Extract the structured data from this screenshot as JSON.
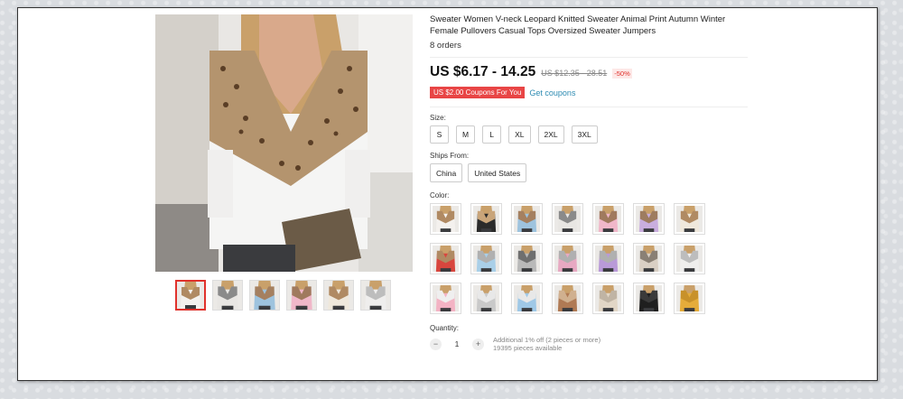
{
  "product": {
    "title": "Sweater Women V-neck Leopard Knitted Sweater Animal Print Autumn Winter Female Pullovers Casual Tops Oversized Sweater Jumpers",
    "orders": "8 orders",
    "price": "US $6.17 - 14.25",
    "old_price": "US $12.35 - 28.51",
    "discount": "-50%",
    "coupon_badge": "US $2.00 Coupons For You",
    "get_coupons": "Get coupons"
  },
  "size": {
    "label": "Size:",
    "options": [
      "S",
      "M",
      "L",
      "XL",
      "2XL",
      "3XL"
    ]
  },
  "ships_from": {
    "label": "Ships From:",
    "options": [
      "China",
      "United States"
    ]
  },
  "color": {
    "label": "Color:",
    "swatches": [
      {
        "body": "#f4f1ee",
        "band": "#b08a63"
      },
      {
        "body": "#2b2b2b",
        "band": "#c9a57a"
      },
      {
        "body": "#9ec3de",
        "band": "#a58060"
      },
      {
        "body": "#e8e6e3",
        "band": "#8a8a8a"
      },
      {
        "body": "#f0b7c9",
        "band": "#a07a5e"
      },
      {
        "body": "#c9aede",
        "band": "#9e7c60"
      },
      {
        "body": "#efe8dc",
        "band": "#b08a63"
      },
      {
        "body": "#d8463e",
        "band": "#b08a63"
      },
      {
        "body": "#a9cfe8",
        "band": "#b0b0b0"
      },
      {
        "body": "#b9b9b9",
        "band": "#6f6f6f"
      },
      {
        "body": "#e7a9c2",
        "band": "#b0b0b0"
      },
      {
        "body": "#b99ad8",
        "band": "#b0b0b0"
      },
      {
        "body": "#d9cfc4",
        "band": "#8a8075"
      },
      {
        "body": "#efeeed",
        "band": "#bdbdbd"
      },
      {
        "body": "#f3b3c4",
        "band": "#efefef"
      },
      {
        "body": "#c9c9c9",
        "band": "#e8e8e8"
      },
      {
        "body": "#9fc8e6",
        "band": "#e8e8e8"
      },
      {
        "body": "#b07a54",
        "band": "#d0b08f"
      },
      {
        "body": "#e2d6c6",
        "band": "#c0b4a4"
      },
      {
        "body": "#1f1f1f",
        "band": "#3a3a3a"
      },
      {
        "body": "#e5ac3a",
        "band": "#c8912a"
      }
    ]
  },
  "quantity": {
    "label": "Quantity:",
    "value": "1",
    "minus": "−",
    "plus": "+",
    "note_1": "Additional 1% off (2 pieces or more)",
    "note_2": "19395 pieces available"
  },
  "gallery": {
    "thumbs": [
      {
        "body": "#f4f1ee",
        "band": "#b08a63"
      },
      {
        "body": "#e8e6e3",
        "band": "#8a8a8a"
      },
      {
        "body": "#9ec3de",
        "band": "#a58060"
      },
      {
        "body": "#f0b7c9",
        "band": "#a07a5e"
      },
      {
        "body": "#efe8dc",
        "band": "#b08a63"
      },
      {
        "body": "#efeeed",
        "band": "#bdbdbd"
      }
    ]
  }
}
